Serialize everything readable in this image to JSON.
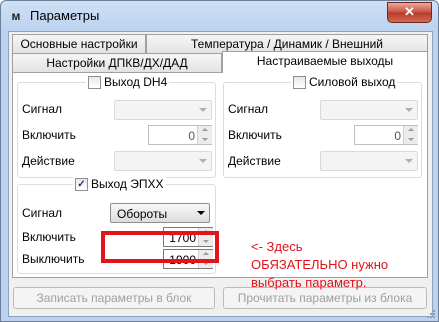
{
  "window": {
    "title": "Параметры",
    "app_icon": "app-logo-icon",
    "close_symbol": "✕"
  },
  "tabs": {
    "row_back": [
      {
        "label": "Основные настройки"
      },
      {
        "label": "Температура / Динамик / Внешний переключатель"
      }
    ],
    "row_front": [
      {
        "label": "Настройки ДПКВ/ДХ/ДАД"
      },
      {
        "label": "Настраиваемые выходы",
        "active": true
      }
    ]
  },
  "groups": {
    "dh4": {
      "title": "Выход DH4",
      "checked": false,
      "signal_label": "Сигнал",
      "signal_value": "",
      "enable_label": "Включить",
      "enable_value": "0",
      "action_label": "Действие",
      "action_value": ""
    },
    "power": {
      "title": "Силовой выход",
      "checked": false,
      "signal_label": "Сигнал",
      "signal_value": "",
      "enable_label": "Включить",
      "enable_value": "0",
      "action_label": "Действие",
      "action_value": ""
    },
    "epxx": {
      "title": "Выход ЭПХХ",
      "checked": true,
      "check_mark": "✓",
      "signal_label": "Сигнал",
      "signal_value": "Обороты",
      "enable_label": "Включить",
      "enable_value": "1700",
      "disable_label": "Выключить",
      "disable_value": "1900"
    }
  },
  "annotation": {
    "line1": "<- Здесь",
    "line2": "ОБЯЗАТЕЛЬНО нужно",
    "line3": "выбрать параметр.",
    "color": "#e0141a"
  },
  "buttons": {
    "write": "Записать параметры в блок",
    "read": "Прочитать параметры из блока"
  }
}
